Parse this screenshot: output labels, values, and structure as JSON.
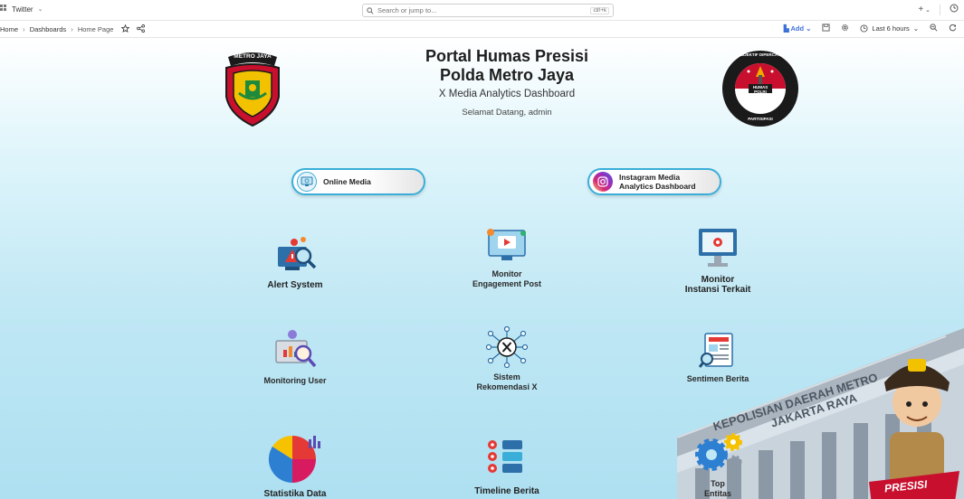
{
  "topbar": {
    "org_name": "Twitter",
    "search_placeholder": "Search or jump to...",
    "search_shortcut": "ctrl+k",
    "plus_label": "+"
  },
  "breadcrumb": {
    "items": [
      "Home",
      "Dashboards",
      "Home Page"
    ]
  },
  "toolbar": {
    "add_label": "Add",
    "time_range": "Last 6 hours"
  },
  "header": {
    "title_line1": "Portal Humas Presisi",
    "title_line2": "Polda Metro Jaya",
    "subtitle": "X Media Analytics Dashboard",
    "welcome": "Selamat Datang, admin"
  },
  "logos": {
    "left_text": "METRO JAYA",
    "right_text_top": "OBJEKTIF  DIPERCAYA",
    "right_text_bottom": "PARTISIPASI",
    "right_badge": "HUMAS POLRI"
  },
  "links": {
    "online_media": "Online Media",
    "instagram": "Instagram Media\nAnalytics Dashboard"
  },
  "tiles": [
    {
      "label": "Alert System",
      "icon": "alert-icon"
    },
    {
      "label": "Monitor\nEngagement Post",
      "icon": "engagement-icon"
    },
    {
      "label": "Monitor\nInstansi Terkait",
      "icon": "monitor-icon"
    },
    {
      "label": "Monitoring User",
      "icon": "user-search-icon"
    },
    {
      "label": "Sistem\nRekomendasi X",
      "icon": "x-network-icon"
    },
    {
      "label": "Sentimen Berita",
      "icon": "news-icon"
    },
    {
      "label": "Statistika Data",
      "icon": "pie-chart-icon"
    },
    {
      "label": "Timeline Berita",
      "icon": "timeline-icon"
    },
    {
      "label": "Top\nEntitas",
      "icon": "gears-icon"
    }
  ],
  "building": {
    "sign_line1": "KEPOLISIAN DAERAH METRO",
    "sign_line2": "JAKARTA RAYA"
  },
  "mascot": {
    "badge_text": "PRESISI"
  },
  "colors": {
    "accent": "#3aaed8",
    "title": "#1e1e1e",
    "add_blue": "#3d71d9"
  }
}
